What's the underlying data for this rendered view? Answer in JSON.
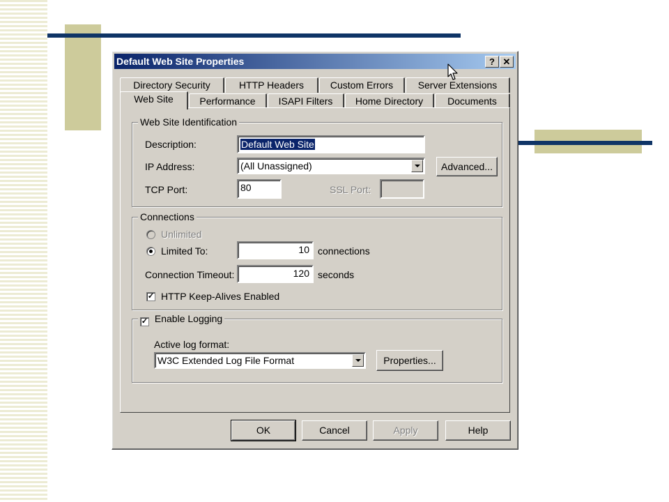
{
  "dialog": {
    "title": "Default Web Site Properties",
    "help_button": "?",
    "close_button": "✕"
  },
  "tabs": {
    "row_back": [
      "Directory Security",
      "HTTP Headers",
      "Custom Errors",
      "Server Extensions"
    ],
    "row_front": [
      "Web Site",
      "Performance",
      "ISAPI Filters",
      "Home Directory",
      "Documents"
    ],
    "active": "Web Site"
  },
  "identification": {
    "legend": "Web Site Identification",
    "description_label": "Description:",
    "description_value": "Default Web Site",
    "ip_label": "IP Address:",
    "ip_value": "(All Unassigned)",
    "advanced_button": "Advanced...",
    "tcp_label": "TCP Port:",
    "tcp_value": "80",
    "ssl_label": "SSL Port:",
    "ssl_value": ""
  },
  "connections": {
    "legend": "Connections",
    "unlimited_label": "Unlimited",
    "limited_label": "Limited To:",
    "limited_value": "10",
    "limited_unit": "connections",
    "timeout_label": "Connection Timeout:",
    "timeout_value": "120",
    "timeout_unit": "seconds",
    "keepalive_label": "HTTP Keep-Alives Enabled",
    "keepalive_checked": true
  },
  "logging": {
    "legend": "Enable Logging",
    "enabled": true,
    "format_label": "Active log format:",
    "format_value": "W3C Extended Log File Format",
    "properties_button": "Properties..."
  },
  "buttons": {
    "ok": "OK",
    "cancel": "Cancel",
    "apply": "Apply",
    "help": "Help"
  },
  "icons": {
    "cursor": "mouse-pointer-icon",
    "dropdown": "chevron-down-icon",
    "check": "checkmark-icon"
  }
}
